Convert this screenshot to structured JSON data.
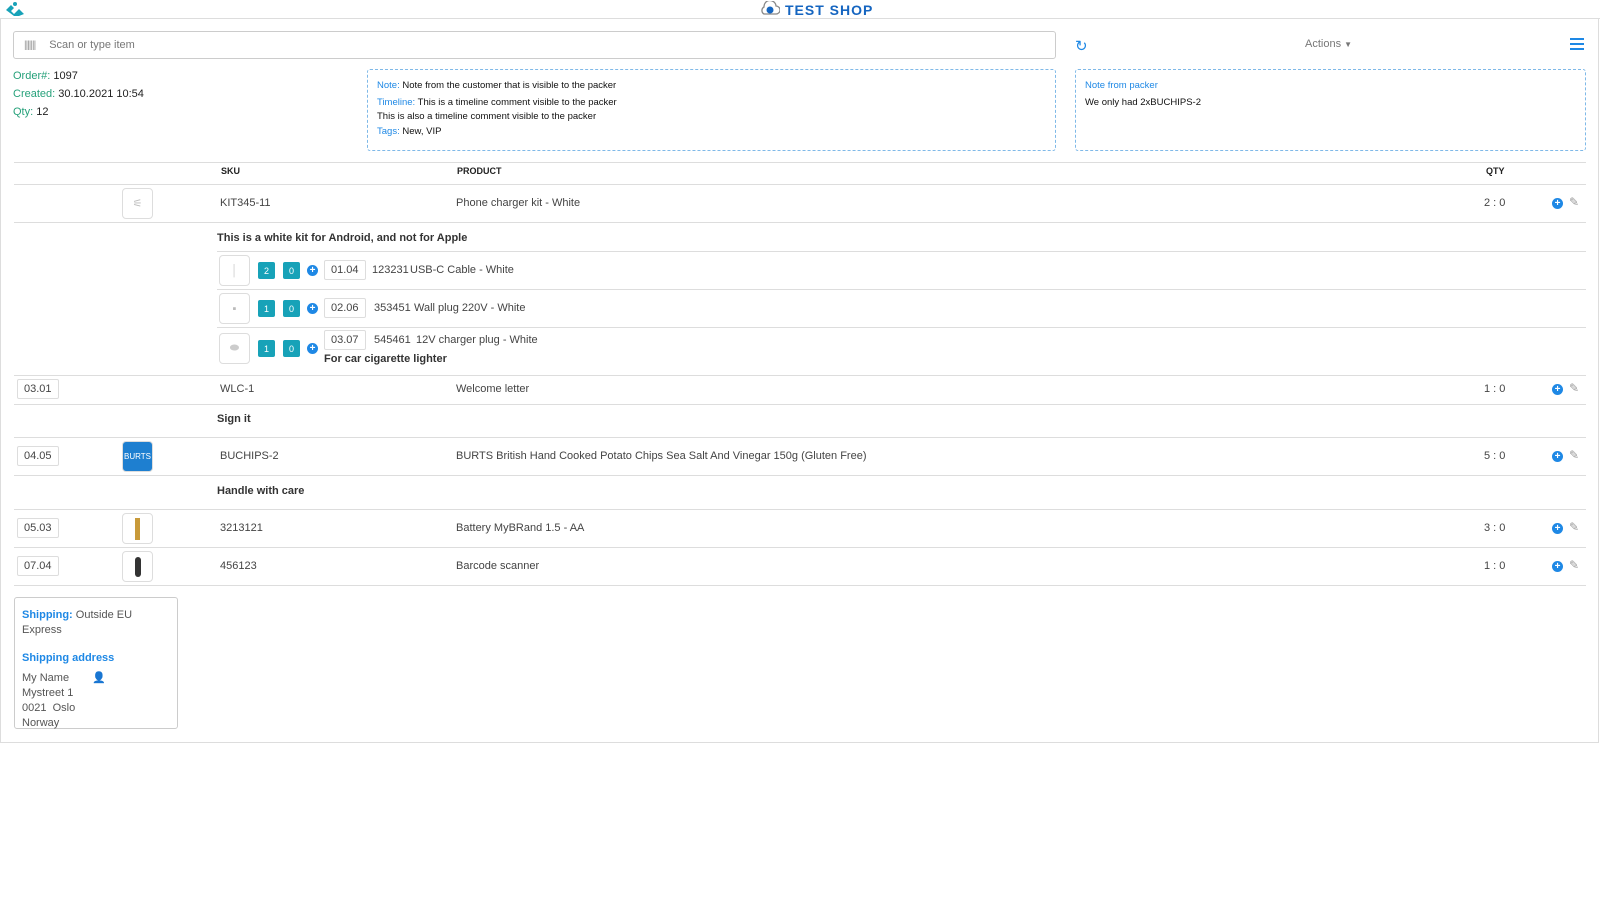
{
  "header": {
    "shop_title": "TEST SHOP"
  },
  "search": {
    "placeholder": "Scan or type item"
  },
  "toolbar": {
    "actions_label": "Actions"
  },
  "order": {
    "order_label": "Order#:",
    "order_no": "1097",
    "created_label": "Created:",
    "created": "30.10.2021 10:54",
    "qty_label": "Qty:",
    "qty": "12"
  },
  "notes": {
    "note_label": "Note:",
    "note": "Note from the customer that is visible to the packer",
    "timeline_label": "Timeline:",
    "timeline1": "This is a timeline comment visible to the packer",
    "timeline2": "This is also a timeline comment visible to the packer",
    "tags_label": "Tags:",
    "tags": "New, VIP"
  },
  "packer_note": {
    "title": "Note from packer",
    "text": "We only had 2xBUCHIPS-2"
  },
  "table": {
    "headers": {
      "sku": "SKU",
      "product": "PRODUCT",
      "qty": "QTY"
    },
    "rows": [
      {
        "loc": "",
        "sku": "KIT345-11",
        "product": "Phone charger kit - White",
        "qty": "2 : 0",
        "note": "This is a white kit for Android, and not for Apple"
      },
      {
        "loc": "03.01",
        "sku": "WLC-1",
        "product": "Welcome letter",
        "qty": "1 : 0",
        "note": "Sign it"
      },
      {
        "loc": "04.05",
        "sku": "BUCHIPS-2",
        "product": "BURTS British Hand Cooked Potato Chips Sea Salt And Vinegar 150g (Gluten Free)",
        "qty": "5 : 0",
        "note": "Handle with care"
      },
      {
        "loc": "05.03",
        "sku": "3213121",
        "product": "Battery MyBRand 1.5 - AA",
        "qty": "3 : 0"
      },
      {
        "loc": "07.04",
        "sku": "456123",
        "product": "Barcode scanner",
        "qty": "1 : 0"
      }
    ],
    "kit_items": [
      {
        "need": "2",
        "picked": "0",
        "loc": "01.04",
        "sku": "123231",
        "product": "USB-C Cable - White"
      },
      {
        "need": "1",
        "picked": "0",
        "loc": "02.06",
        "sku": "353451",
        "product": "Wall plug 220V - White"
      },
      {
        "need": "1",
        "picked": "0",
        "loc": "03.07",
        "sku": "545461",
        "product": "12V charger plug - White",
        "note": "For car cigarette lighter"
      }
    ]
  },
  "shipping": {
    "label": "Shipping:",
    "method": "Outside EU Express",
    "address_title": "Shipping address",
    "name": "My Name",
    "street": "Mystreet 1",
    "city": "0021  Oslo",
    "country": "Norway"
  }
}
